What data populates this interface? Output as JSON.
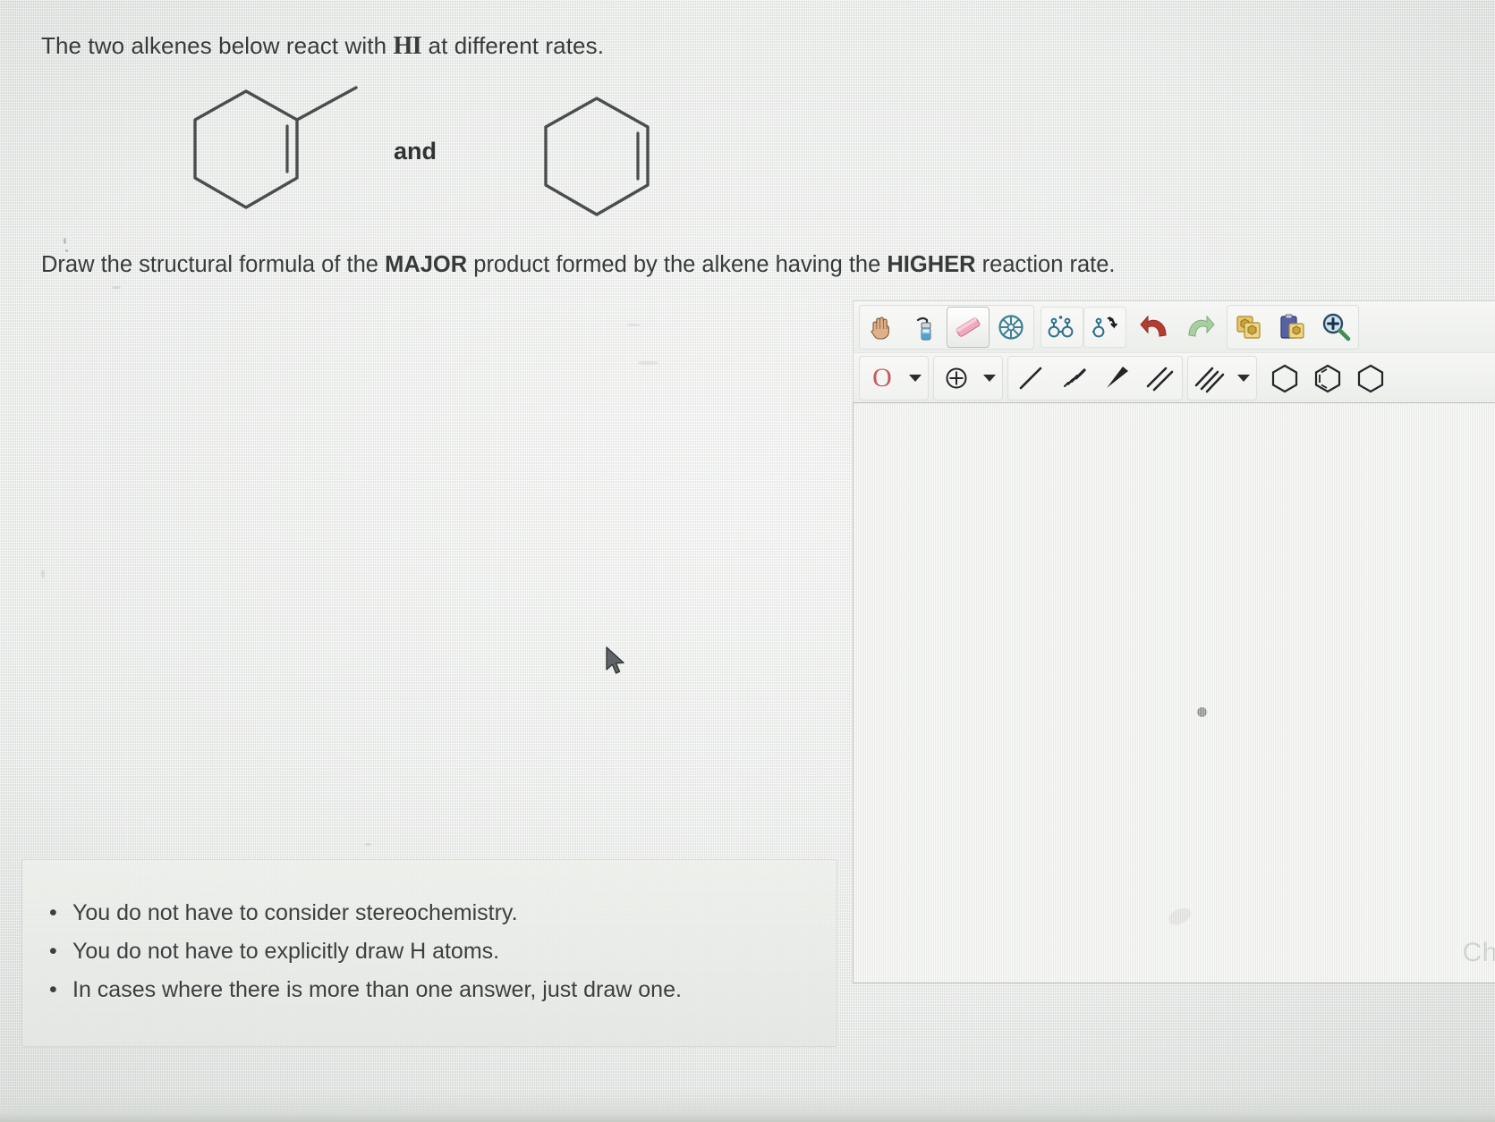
{
  "question": {
    "prompt_before": "The two alkenes below react with ",
    "reagent": "HI",
    "prompt_after": " at different rates.",
    "connector": "and",
    "instruction_parts": [
      {
        "text": "Draw the structural formula of the ",
        "bold": false
      },
      {
        "text": "MAJOR",
        "bold": true
      },
      {
        "text": " product formed by the alkene having the ",
        "bold": false
      },
      {
        "text": "HIGHER",
        "bold": true
      },
      {
        "text": " reaction rate.",
        "bold": false
      }
    ]
  },
  "molecules": [
    {
      "name": "1-methylcyclohexene",
      "description": "cyclohexene ring with a double bond on the right-hand side and a methyl substituent at the top-right vertex"
    },
    {
      "name": "cyclohexene",
      "description": "cyclohexene ring with a double bond on the right-hand side"
    }
  ],
  "editor": {
    "toolbar_row1": [
      {
        "name": "pan-hand-tool",
        "label": "Pan",
        "icon": "hand-icon",
        "active": false
      },
      {
        "name": "eraser-spray-tool",
        "label": "Clean",
        "icon": "spray-bottle-icon",
        "active": false
      },
      {
        "name": "eraser-tool",
        "label": "Eraser",
        "icon": "eraser-icon",
        "active": true
      },
      {
        "name": "clean-structure-tool",
        "label": "Clean Structure",
        "icon": "snowflake-icon",
        "active": false
      },
      {
        "name": "stereo-tool",
        "label": "Stereochemistry",
        "icon": "stereo-atoms-icon",
        "active": false
      },
      {
        "name": "flip-tool",
        "label": "Flip",
        "icon": "flip-icon",
        "active": false
      },
      {
        "name": "undo-tool",
        "label": "Undo",
        "icon": "undo-arrow-icon",
        "active": false
      },
      {
        "name": "redo-tool",
        "label": "Redo",
        "icon": "redo-arrow-icon",
        "active": false
      },
      {
        "name": "copy-tool",
        "label": "Copy",
        "icon": "copy-icon",
        "active": false
      },
      {
        "name": "paste-tool",
        "label": "Paste",
        "icon": "paste-icon",
        "active": false
      },
      {
        "name": "zoom-in-tool",
        "label": "Zoom In",
        "icon": "magnifier-plus-icon",
        "active": false
      }
    ],
    "toolbar_row2": [
      {
        "name": "atom-label-tool",
        "label": "O",
        "icon": "atom-letter-icon",
        "has_caret": true
      },
      {
        "name": "charge-tool",
        "label": "Charge",
        "icon": "circle-plus-icon",
        "has_caret": true
      },
      {
        "name": "single-bond-tool",
        "label": "Single Bond",
        "icon": "single-bond-icon",
        "has_caret": false
      },
      {
        "name": "hashed-wedge-bond-tool",
        "label": "Hashed Wedge",
        "icon": "hashed-wedge-icon",
        "has_caret": false
      },
      {
        "name": "solid-wedge-bond-tool",
        "label": "Solid Wedge",
        "icon": "solid-wedge-icon",
        "has_caret": false
      },
      {
        "name": "double-bond-tool",
        "label": "Double Bond",
        "icon": "double-bond-icon",
        "has_caret": false
      },
      {
        "name": "triple-bond-tool",
        "label": "Triple Bond",
        "icon": "triple-bond-icon",
        "has_caret": true
      },
      {
        "name": "cyclohexane-ring-tool",
        "label": "Cyclohexane",
        "icon": "hexagon-icon",
        "has_caret": false
      },
      {
        "name": "benzene-ring-tool",
        "label": "Benzene",
        "icon": "benzene-icon",
        "has_caret": false
      },
      {
        "name": "ring-tool-extra",
        "label": "Ring",
        "icon": "hexagon-icon",
        "has_caret": false
      }
    ],
    "canvas": {
      "watermark": "Ch",
      "dot_present": true
    }
  },
  "notes": {
    "items": [
      "You do not have to consider stereochemistry.",
      "You do not have to explicitly draw H atoms.",
      "In cases where there is more than one answer, just draw one."
    ]
  },
  "colors": {
    "page_bg": "#eceeec",
    "text": "#37393a",
    "atom_label": "#c75a5f",
    "canvas_bg": "#f3f4f1",
    "panel_bg": "#e9ebe7",
    "undo_red": "#b63b33",
    "redo_green": "#a8cfa2"
  }
}
